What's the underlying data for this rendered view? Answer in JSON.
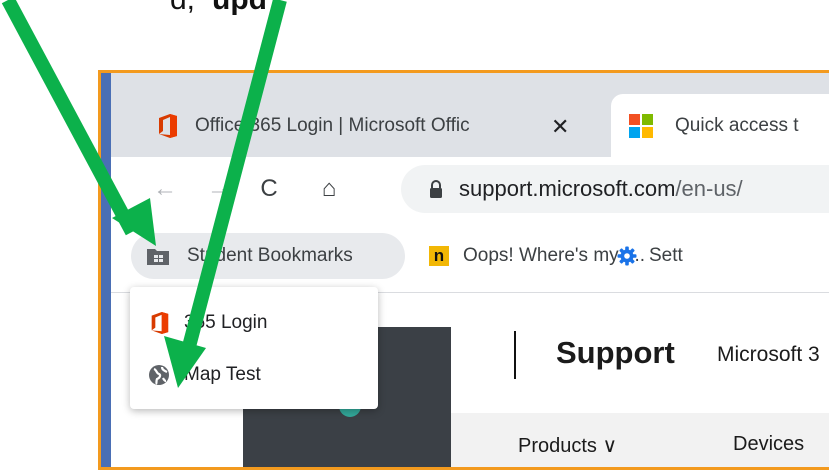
{
  "caption": {
    "part_a": "d,",
    "part_b": "upd"
  },
  "colors": {
    "frame_border": "#f39a1e",
    "arrow_green": "#0cb14b",
    "tab_strip_bg": "#dee1e6",
    "bookmark_folder_bg": "#e8eaed"
  },
  "tabs": [
    {
      "title": "Office 365 Login | Microsoft Offic",
      "icon": "office-logo-icon",
      "close_label": "✕",
      "active": false
    },
    {
      "title": "Quick access t",
      "icon": "microsoft-logo-icon",
      "active": true
    }
  ],
  "toolbar": {
    "back_icon": "back-arrow-icon",
    "forward_icon": "forward-arrow-icon",
    "reload_icon": "reload-icon",
    "home_icon": "home-icon",
    "back_glyph": "←",
    "forward_glyph": "→",
    "reload_glyph": "C",
    "home_glyph": "⌂",
    "url_host": "support.microsoft.com",
    "url_path": "/en-us/"
  },
  "bookmarks_bar": {
    "folder_label": "Student Bookmarks",
    "items": [
      {
        "label": "Oops! Where's my t...",
        "icon": "n-icon",
        "icon_glyph": "n"
      },
      {
        "label": "Sett",
        "icon": "gear-icon"
      }
    ]
  },
  "dropdown": {
    "items": [
      {
        "label": "365 Login",
        "icon": "office-logo-icon"
      },
      {
        "label": "Map Test",
        "icon": "globe-icon"
      }
    ]
  },
  "page": {
    "support_title": "Support",
    "support_sub": "Microsoft 3",
    "nav": [
      "Products ∨",
      "Devices"
    ]
  }
}
